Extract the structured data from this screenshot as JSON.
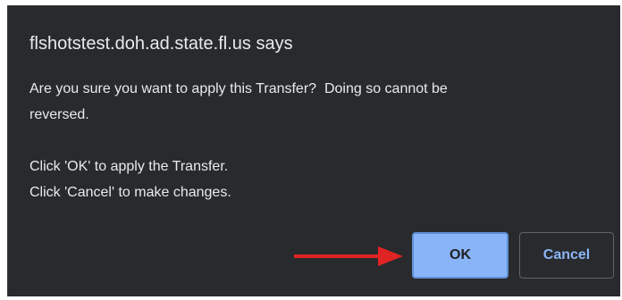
{
  "dialog": {
    "origin_title": "flshotstest.doh.ad.state.fl.us says",
    "message_lines": [
      "Are you sure you want to apply this Transfer?  Doing so cannot be",
      "reversed.",
      "",
      "Click 'OK' to apply the Transfer.",
      "Click 'Cancel' to make changes."
    ],
    "ok_label": "OK",
    "cancel_label": "Cancel"
  },
  "annotation": {
    "arrow_icon": "right-arrow-icon",
    "arrow_color": "#e02424"
  },
  "colors": {
    "dialog_bg": "#292a2d",
    "text": "#e8eaed",
    "accent": "#8ab4f8"
  }
}
